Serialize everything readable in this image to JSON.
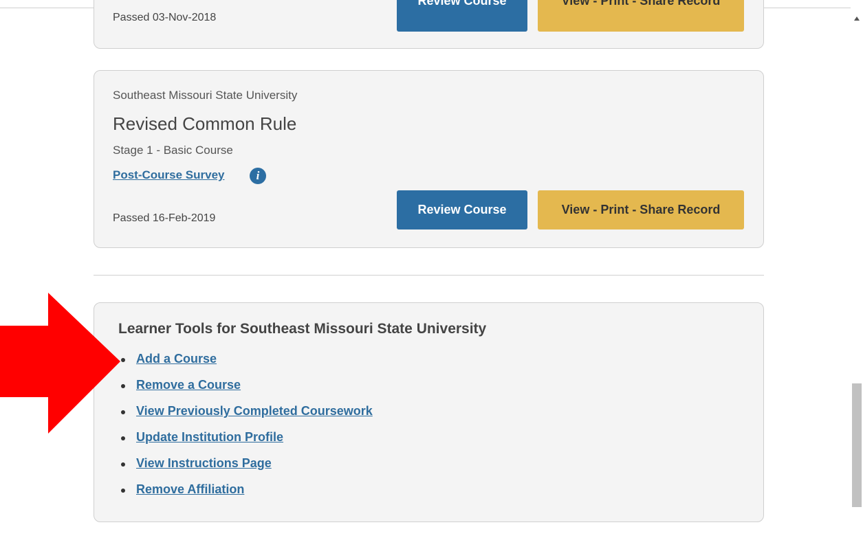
{
  "courses": [
    {
      "passed": "Passed 03-Nov-2018",
      "review_label": "Review Course",
      "share_label": "View - Print - Share Record"
    },
    {
      "institution": "Southeast Missouri State University",
      "title": "Revised Common Rule",
      "stage": "Stage 1 - Basic Course",
      "survey_link": "Post-Course Survey",
      "info_icon_glyph": "i",
      "passed": "Passed 16-Feb-2019",
      "review_label": "Review Course",
      "share_label": "View - Print - Share Record"
    }
  ],
  "learner_tools": {
    "heading": "Learner Tools for Southeast Missouri State University",
    "links": [
      "Add a Course",
      "Remove a Course",
      "View Previously Completed Coursework",
      "Update Institution Profile",
      "View Instructions Page",
      "Remove Affiliation"
    ]
  },
  "annotation": {
    "icon": "red-arrow-right-icon",
    "color": "#ff0000"
  },
  "colors": {
    "review_button": "#2c6ea3",
    "share_button": "#e4b84f",
    "link": "#2f6d9e",
    "card_background": "#f4f4f4"
  }
}
